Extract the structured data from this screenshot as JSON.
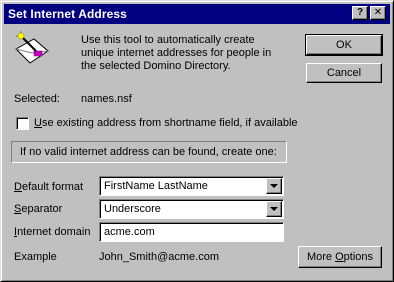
{
  "window": {
    "title": "Set Internet Address",
    "help_button": "?",
    "close_button": "✕"
  },
  "description": "Use this tool to automatically create unique internet addresses for people in the selected Domino Directory.",
  "selected": {
    "label": "Selected:",
    "value": "names.nsf"
  },
  "checkbox": {
    "mnemonic": "U",
    "label_rest": "se existing address from shortname field, if available",
    "checked": false
  },
  "info_text": "If no valid internet address can be found, create one:",
  "default_format": {
    "mnemonic": "D",
    "label_rest": "efault format",
    "value": "FirstName LastName"
  },
  "separator": {
    "mnemonic": "S",
    "label_rest": "eparator",
    "value": "Underscore"
  },
  "internet_domain": {
    "mnemonic": "I",
    "label_rest": "nternet domain",
    "value": "acme.com"
  },
  "example": {
    "label": "Example",
    "value": "John_Smith@acme.com"
  },
  "buttons": {
    "ok": "OK",
    "cancel": "Cancel",
    "more_options_pre": "More ",
    "more_options_mnemonic": "O",
    "more_options_post": "ptions"
  },
  "colors": {
    "titlebar": "#000080",
    "face": "#c0c0c0"
  },
  "icons": {
    "tool_icon": "envelope-wand-icon"
  }
}
